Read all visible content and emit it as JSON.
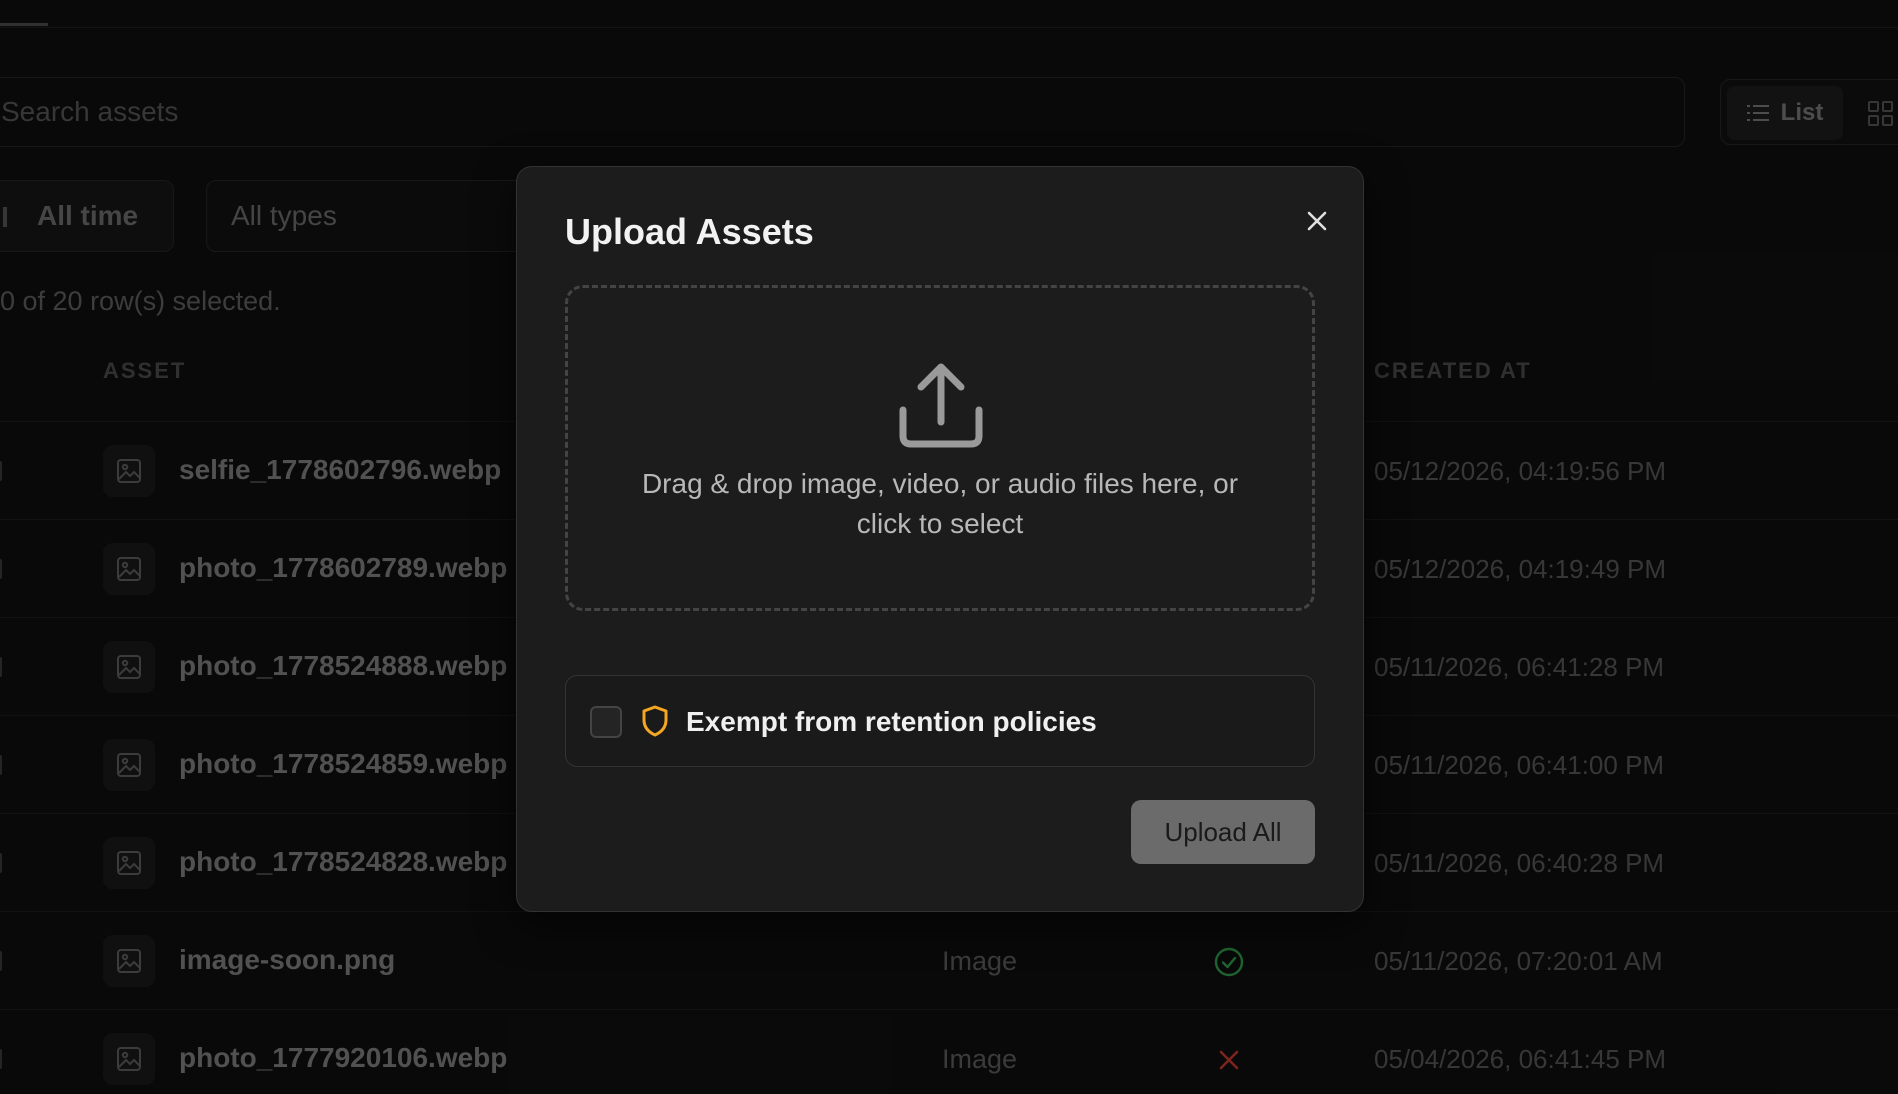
{
  "search": {
    "placeholder": "Search assets"
  },
  "view_toggle": {
    "list_label": "List",
    "active": "list"
  },
  "filters": {
    "time_label": "All time",
    "types_label": "All types"
  },
  "selection_status": "0 of 20 row(s) selected.",
  "table": {
    "headers": {
      "asset": "ASSET",
      "created_at": "CREATED AT"
    },
    "rows": [
      {
        "name": "selfie_1778602796.webp",
        "type": "",
        "status": "",
        "created_at": "05/12/2026, 04:19:56 PM"
      },
      {
        "name": "photo_1778602789.webp",
        "type": "",
        "status": "",
        "created_at": "05/12/2026, 04:19:49 PM"
      },
      {
        "name": "photo_1778524888.webp",
        "type": "",
        "status": "",
        "created_at": "05/11/2026, 06:41:28 PM"
      },
      {
        "name": "photo_1778524859.webp",
        "type": "",
        "status": "",
        "created_at": "05/11/2026, 06:41:00 PM"
      },
      {
        "name": "photo_1778524828.webp",
        "type": "",
        "status": "",
        "created_at": "05/11/2026, 06:40:28 PM"
      },
      {
        "name": "image-soon.png",
        "type": "Image",
        "status": "success",
        "created_at": "05/11/2026, 07:20:01 AM"
      },
      {
        "name": "photo_1777920106.webp",
        "type": "Image",
        "status": "failed",
        "created_at": "05/04/2026, 06:41:45 PM"
      }
    ]
  },
  "modal": {
    "title": "Upload Assets",
    "dropzone_text": "Drag & drop image, video, or audio files here, or click to select",
    "retention_label": "Exempt from retention policies",
    "retention_checked": false,
    "upload_button": "Upload All"
  },
  "colors": {
    "status_success": "#2f9a4a",
    "status_failed": "#c0392b",
    "shield_accent": "#f5a623"
  }
}
